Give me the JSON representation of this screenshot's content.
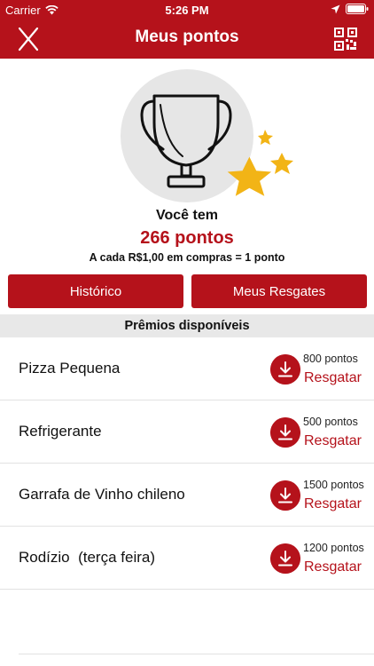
{
  "status_bar": {
    "carrier": "Carrier",
    "time": "5:26 PM",
    "icons": [
      "wifi-icon",
      "location-arrow-icon",
      "battery-icon"
    ]
  },
  "nav": {
    "title": "Meus pontos",
    "left_icon": "close-icon",
    "right_icon": "qr-code-icon"
  },
  "summary": {
    "you_have": "Você tem",
    "points": "266 pontos",
    "rule": "A cada R$1,00 em compras = 1 ponto"
  },
  "buttons": {
    "history": "Histórico",
    "redemptions": "Meus Resgates"
  },
  "prizes_header": "Prêmios disponíveis",
  "prizes": [
    {
      "name": "Pizza Pequena",
      "cost": "800 pontos",
      "action": "Resgatar"
    },
    {
      "name": "Refrigerante",
      "cost": "500 pontos",
      "action": "Resgatar"
    },
    {
      "name": "Garrafa de Vinho chileno",
      "cost": "1500 pontos",
      "action": "Resgatar"
    },
    {
      "name": "Rodízio  (terça feira)",
      "cost": "1200 pontos",
      "action": "Resgatar"
    }
  ],
  "colors": {
    "brand_red": "#b5121b",
    "star_gold": "#f2b416",
    "circle_gray": "#e6e6e6"
  }
}
